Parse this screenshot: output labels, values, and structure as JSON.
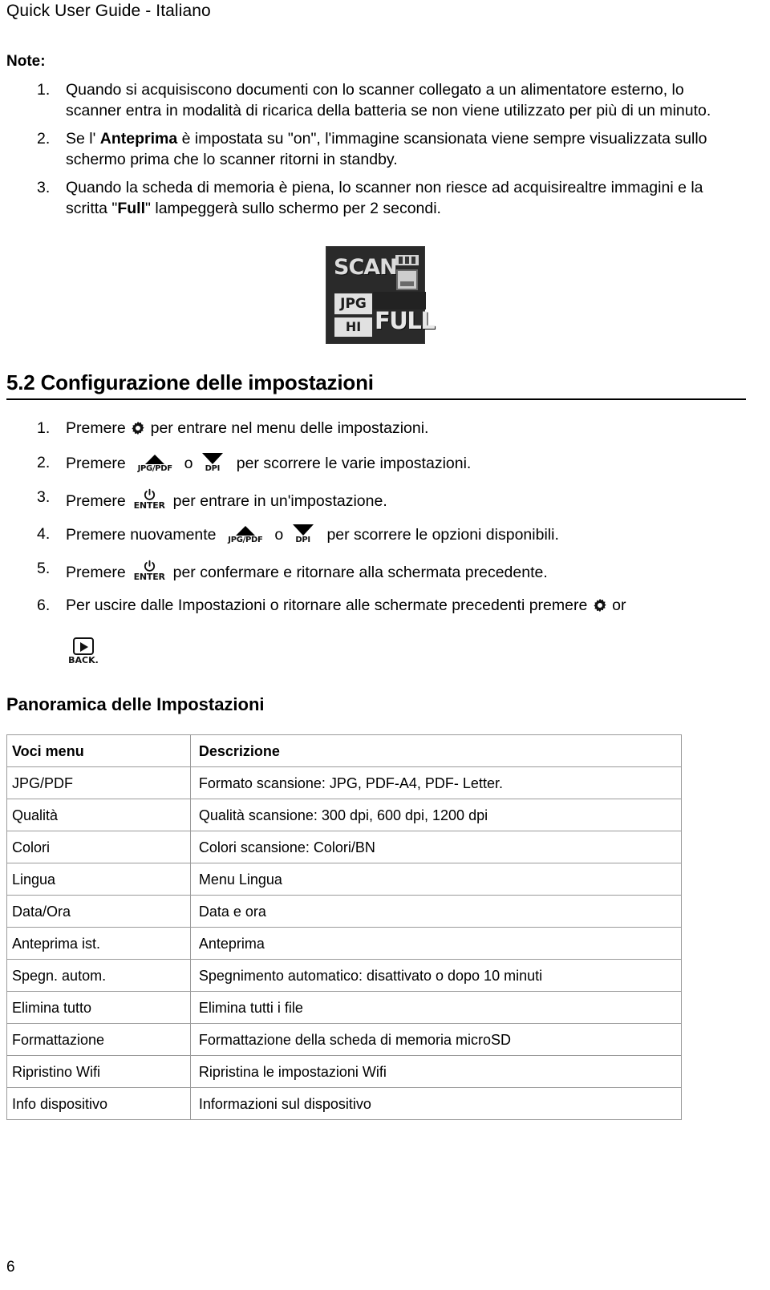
{
  "header": {
    "title": "Quick User Guide - Italiano"
  },
  "notes": {
    "title": "Note:",
    "items": [
      {
        "num": "1.",
        "parts": [
          {
            "text": "Quando si acquisiscono documenti con lo scanner collegato a un alimentatore esterno, lo scanner entra in modalità di ricarica della batteria se non viene utilizzato per più di un minuto.",
            "bold": false
          }
        ]
      },
      {
        "num": "2.",
        "parts": [
          {
            "text": "Se l' ",
            "bold": false
          },
          {
            "text": "Anteprima",
            "bold": true
          },
          {
            "text": " è impostata su \"on\", l'immagine scansionata viene sempre visualizzata sullo schermo prima che lo scanner ritorni in standby.",
            "bold": false
          }
        ]
      },
      {
        "num": "3.",
        "parts": [
          {
            "text": "Quando la scheda di memoria è piena, lo scanner non riesce ad acquisirealtre immagini e la scritta \"",
            "bold": false
          },
          {
            "text": "Full",
            "bold": true
          },
          {
            "text": "\" lampeggerà sullo schermo per 2 secondi.",
            "bold": false
          }
        ]
      }
    ]
  },
  "lcd": {
    "scan_label": "SCAN",
    "format_label": "JPG",
    "quality_label": "HI",
    "status_label": "FULL"
  },
  "section": {
    "heading": "5.2 Configurazione delle impostazioni"
  },
  "icons": {
    "gear": "gear-icon",
    "up": "up-arrow-icon",
    "down": "down-arrow-icon",
    "power": "power-icon",
    "back": "back-icon",
    "jpgpdf_label": "JPG/PDF",
    "dpi_label": "DPI",
    "enter_label": "ENTER",
    "back_label": "BACK."
  },
  "steps": [
    {
      "num": "1.",
      "pre": "Premere",
      "post": "per entrare nel menu delle impostazioni."
    },
    {
      "num": "2.",
      "pre": "Premere",
      "mid": "o",
      "post": "per scorrere le varie impostazioni."
    },
    {
      "num": "3.",
      "pre": "Premere",
      "post": "per entrare in un'impostazione."
    },
    {
      "num": "4.",
      "pre": "Premere nuovamente",
      "mid": "o",
      "post": "per scorrere le opzioni disponibili."
    },
    {
      "num": "5.",
      "pre": "Premere",
      "post": "per confermare e ritornare alla schermata precedente."
    },
    {
      "num": "6.",
      "pre": "Per uscire dalle Impostazioni o ritornare alle schermate precedenti premere",
      "post": "or"
    }
  ],
  "overview": {
    "heading": "Panoramica delle Impostazioni",
    "columns": [
      "Voci menu",
      "Descrizione"
    ],
    "rows": [
      {
        "item": "JPG/PDF",
        "desc": "Formato scansione: JPG, PDF-A4, PDF- Letter."
      },
      {
        "item": "Qualità",
        "desc": "Qualità scansione: 300 dpi, 600 dpi, 1200 dpi"
      },
      {
        "item": "Colori",
        "desc": "Colori scansione: Colori/BN"
      },
      {
        "item": "Lingua",
        "desc": "Menu Lingua"
      },
      {
        "item": "Data/Ora",
        "desc": "Data e ora"
      },
      {
        "item": "Anteprima ist.",
        "desc": "Anteprima"
      },
      {
        "item": "Spegn. autom.",
        "desc": "Spegnimento automatico: disattivato o dopo 10 minuti"
      },
      {
        "item": "Elimina tutto",
        "desc": "Elimina tutti i file"
      },
      {
        "item": "Formattazione",
        "desc": "Formattazione della scheda di memoria microSD"
      },
      {
        "item": "Ripristino Wifi",
        "desc": "Ripristina le impostazioni Wifi"
      },
      {
        "item": "Info dispositivo",
        "desc": "Informazioni sul dispositivo"
      }
    ]
  },
  "footer": {
    "page_number": "6"
  }
}
